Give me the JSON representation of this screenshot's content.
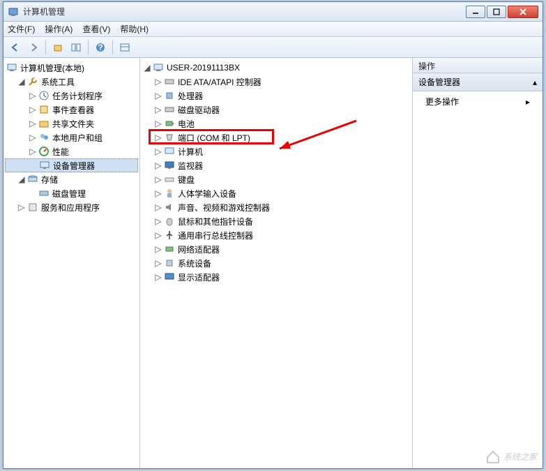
{
  "title": "计算机管理",
  "menu": {
    "file": "文件(F)",
    "action": "操作(A)",
    "view": "查看(V)",
    "help": "帮助(H)"
  },
  "left_tree": {
    "root": "计算机管理(本地)",
    "sys_tools": "系统工具",
    "task_sched": "任务计划程序",
    "event_viewer": "事件查看器",
    "shared_folders": "共享文件夹",
    "local_users": "本地用户和组",
    "performance": "性能",
    "device_mgr": "设备管理器",
    "storage": "存储",
    "disk_mgmt": "磁盘管理",
    "services": "服务和应用程序"
  },
  "mid_tree": {
    "root": "USER-20191113BX",
    "ide": "IDE ATA/ATAPI 控制器",
    "cpu": "处理器",
    "disk_drives": "磁盘驱动器",
    "battery": "电池",
    "ports": "端口 (COM 和 LPT)",
    "computer": "计算机",
    "monitor": "监视器",
    "keyboard": "键盘",
    "hid": "人体学输入设备",
    "sound": "声音、视频和游戏控制器",
    "mouse": "鼠标和其他指针设备",
    "usb": "通用串行总线控制器",
    "network": "网络适配器",
    "sysdev": "系统设备",
    "display": "显示适配器"
  },
  "right": {
    "header": "操作",
    "section": "设备管理器",
    "more": "更多操作"
  },
  "watermark": "系统之家"
}
